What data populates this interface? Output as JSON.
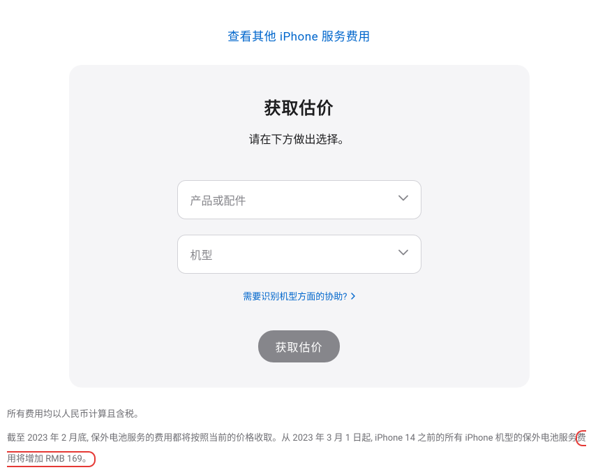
{
  "topLink": {
    "label": "查看其他 iPhone 服务费用"
  },
  "card": {
    "title": "获取估价",
    "subtitle": "请在下方做出选择。",
    "select1": {
      "placeholder": "产品或配件"
    },
    "select2": {
      "placeholder": "机型"
    },
    "helpLink": {
      "label": "需要识别机型方面的协助?"
    },
    "submitButton": {
      "label": "获取估价"
    }
  },
  "footer": {
    "line1": "所有费用均以人民币计算且含税。",
    "line2_part1": "截至 2023 年 2 月底, 保外电池服务的费用都将按照当前的价格收取。从 2023 年 3 月 1 日起, iPhone 14 之前的所有 iPhone 机型的保外电池服务",
    "line2_highlight": "费用将增加 RMB 169。"
  }
}
